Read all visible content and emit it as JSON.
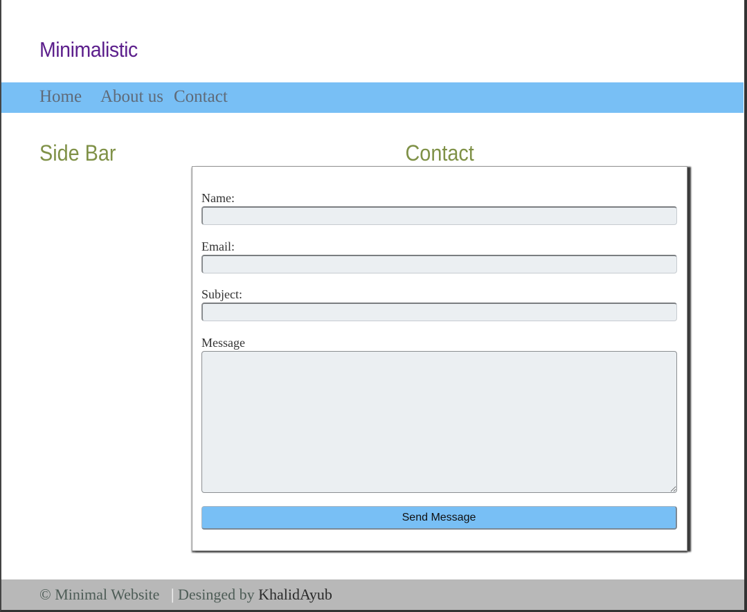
{
  "site": {
    "logo": "Minimalistic"
  },
  "nav": {
    "items": [
      {
        "label": "Home"
      },
      {
        "label": "About us"
      },
      {
        "label": "Contact"
      }
    ]
  },
  "sidebar": {
    "title": "Side Bar"
  },
  "contact": {
    "title": "Contact",
    "fields": {
      "name": {
        "label": "Name:",
        "value": ""
      },
      "email": {
        "label": "Email:",
        "value": ""
      },
      "subject": {
        "label": "Subject:",
        "value": ""
      },
      "message": {
        "label": "Message",
        "value": ""
      }
    },
    "send_label": "Send Message"
  },
  "footer": {
    "copyright": "© Minimal Website",
    "separator": "|",
    "designed_by": "Desinged by",
    "author": "KhalidAyub"
  },
  "colors": {
    "accent": "#78bff5",
    "logo": "#5c1f8c",
    "heading": "#7f9147",
    "footer_bg": "#b8b8b8"
  }
}
